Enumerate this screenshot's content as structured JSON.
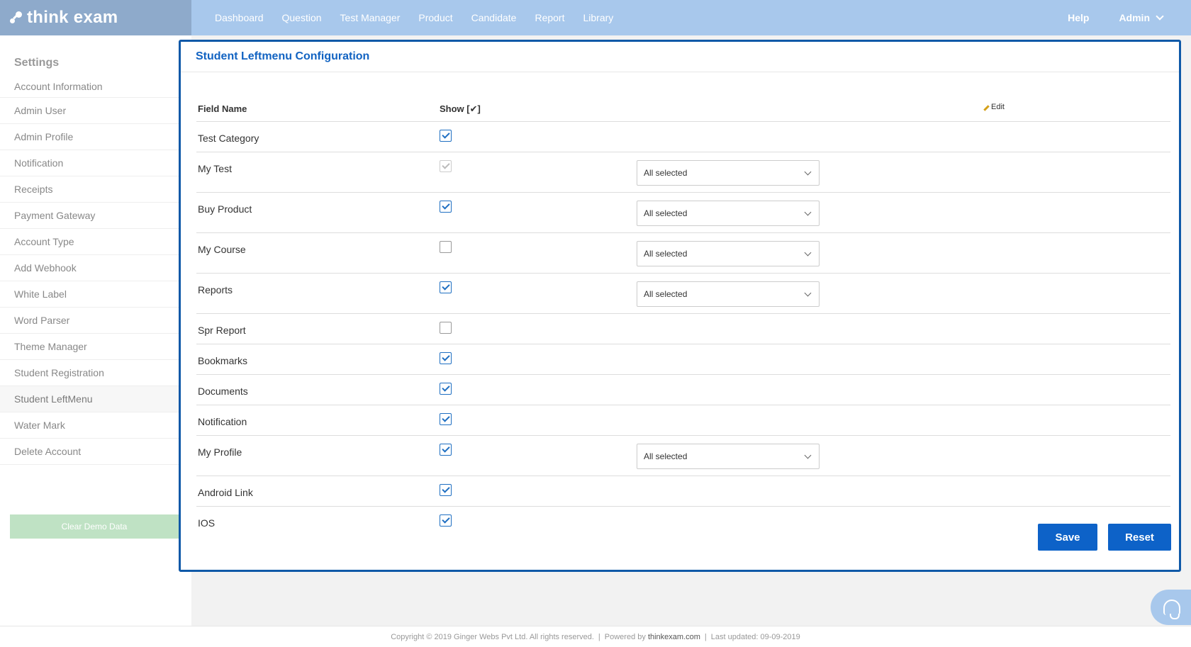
{
  "brand": {
    "name": "think exam"
  },
  "nav": {
    "items": [
      "Dashboard",
      "Question",
      "Test Manager",
      "Product",
      "Candidate",
      "Report",
      "Library"
    ],
    "help": "Help",
    "admin": "Admin"
  },
  "sidebar": {
    "title": "Settings",
    "items": [
      "Account Information",
      "Admin User",
      "Admin Profile",
      "Notification",
      "Receipts",
      "Payment Gateway",
      "Account Type",
      "Add Webhook",
      "White Label",
      "Word Parser",
      "Theme Manager",
      "Student Registration",
      "Student LeftMenu",
      "Water Mark",
      "Delete Account"
    ],
    "active": "Student LeftMenu",
    "demo_button": "Clear Demo Data"
  },
  "panel": {
    "title": "Student Leftmenu Configuration",
    "headers": {
      "field": "Field Name",
      "show": "Show [✔]",
      "edit": "Edit"
    },
    "rows": [
      {
        "name": "Test Category",
        "state": "checked",
        "select": null
      },
      {
        "name": "My Test",
        "state": "disabled",
        "select": "All selected"
      },
      {
        "name": "Buy Product",
        "state": "checked",
        "select": "All selected"
      },
      {
        "name": "My Course",
        "state": "unchecked",
        "select": "All selected"
      },
      {
        "name": "Reports",
        "state": "checked",
        "select": "All selected"
      },
      {
        "name": "Spr Report",
        "state": "unchecked",
        "select": null
      },
      {
        "name": "Bookmarks",
        "state": "checked",
        "select": null
      },
      {
        "name": "Documents",
        "state": "checked",
        "select": null
      },
      {
        "name": "Notification",
        "state": "checked",
        "select": null
      },
      {
        "name": "My Profile",
        "state": "checked",
        "select": "All selected"
      },
      {
        "name": "Android Link",
        "state": "checked",
        "select": null
      },
      {
        "name": "IOS",
        "state": "checked",
        "select": null
      }
    ],
    "save_label": "Save",
    "reset_label": "Reset"
  },
  "footer": {
    "copyright": "Copyright © 2019 Ginger Webs Pvt Ltd. All rights reserved.",
    "powered_prefix": "Powered by",
    "powered_link": "thinkexam.com",
    "updated": "Last updated: 09-09-2019"
  },
  "colors": {
    "topbar": "#a8c8ec",
    "logo_bg": "#8eaacb",
    "primary": "#0d62c8",
    "panel_border": "#0f59a8",
    "demo_button": "#bfe2c4"
  },
  "icons": [
    "logo-icon",
    "chevron-down-icon",
    "pencil-icon",
    "checkbox-icon",
    "support-headset-icon"
  ]
}
